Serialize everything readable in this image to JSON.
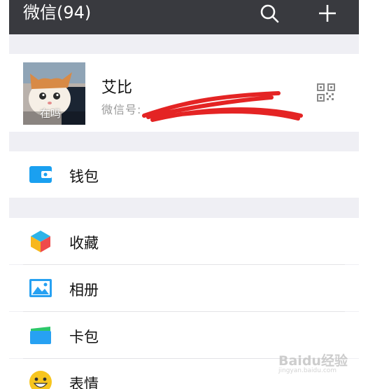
{
  "header": {
    "title": "微信(94)",
    "search_icon": "search-icon",
    "add_icon": "plus-icon",
    "bg_color": "#393a3f"
  },
  "profile": {
    "name": "艾比",
    "wechat_id_label": "微信号: ",
    "avatar_caption": "在吗",
    "qr_icon": "qr-code-icon"
  },
  "menu": {
    "wallet": {
      "label": "钱包",
      "icon": "wallet-icon",
      "color": "#1aa0f0"
    },
    "favorites": {
      "label": "收藏",
      "icon": "cube-icon"
    },
    "album": {
      "label": "相册",
      "icon": "album-icon",
      "color": "#27a1f2"
    },
    "cards": {
      "label": "卡包",
      "icon": "card-package-icon"
    },
    "stickers": {
      "label": "表情",
      "icon": "smiley-icon",
      "color": "#f7c51e"
    }
  },
  "watermark": {
    "text": "Baidu经验",
    "sub": "jingyan.baidu.com"
  }
}
